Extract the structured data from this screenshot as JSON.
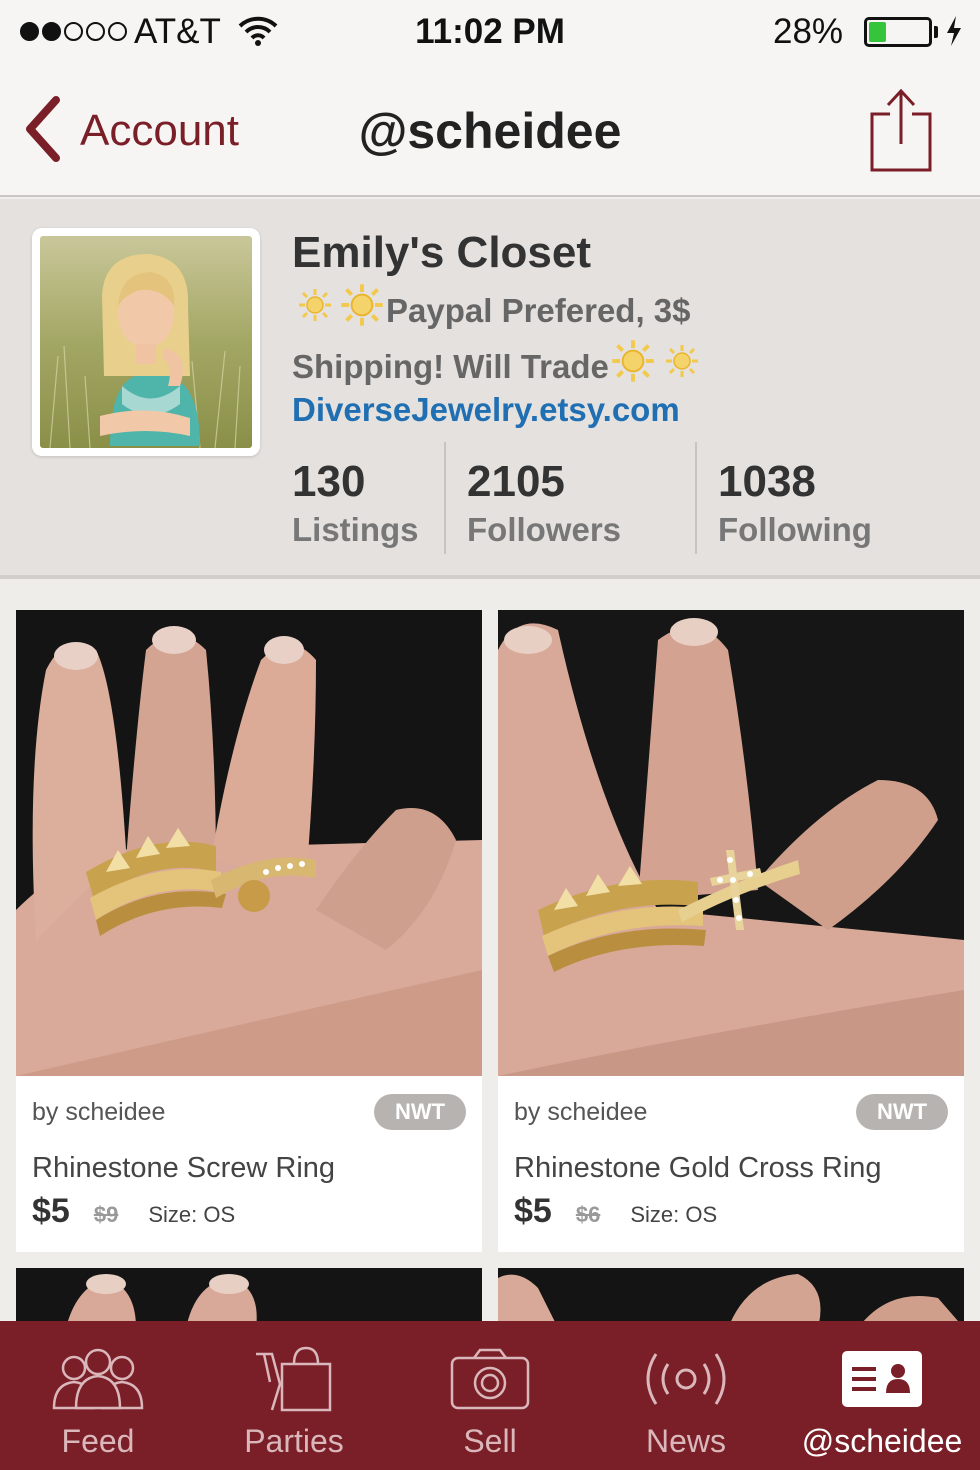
{
  "status_bar": {
    "carrier": "AT&T",
    "time": "11:02 PM",
    "battery_percent": "28%",
    "battery_level": 0.28,
    "signal_bars": 2,
    "signal_total": 5
  },
  "nav": {
    "back_label": "Account",
    "title": "@scheidee"
  },
  "profile": {
    "name": "Emily's Closet",
    "bio_line1": "Paypal Prefered, 3$",
    "bio_line2": "Shipping! Will Trade",
    "link": "DiverseJewelry.etsy.com",
    "stats": [
      {
        "value": "130",
        "label": "Listings"
      },
      {
        "value": "2105",
        "label": "Followers"
      },
      {
        "value": "1038",
        "label": "Following"
      }
    ]
  },
  "listings": [
    {
      "seller": "by scheidee",
      "badge": "NWT",
      "title": "Rhinestone Screw Ring",
      "price": "$5",
      "original_price": "$9",
      "size": "Size: OS"
    },
    {
      "seller": "by scheidee",
      "badge": "NWT",
      "title": "Rhinestone Gold Cross Ring",
      "price": "$5",
      "original_price": "$6",
      "size": "Size: OS"
    }
  ],
  "tabs": [
    {
      "label": "Feed",
      "icon": "people-icon"
    },
    {
      "label": "Parties",
      "icon": "party-bag-icon"
    },
    {
      "label": "Sell",
      "icon": "camera-icon"
    },
    {
      "label": "News",
      "icon": "broadcast-icon"
    },
    {
      "label": "@scheidee",
      "icon": "profile-card-icon"
    }
  ],
  "colors": {
    "brand": "#7a1f28",
    "link": "#1f6fb2",
    "battery": "#37c43d",
    "badge": "#b7b3b0"
  }
}
